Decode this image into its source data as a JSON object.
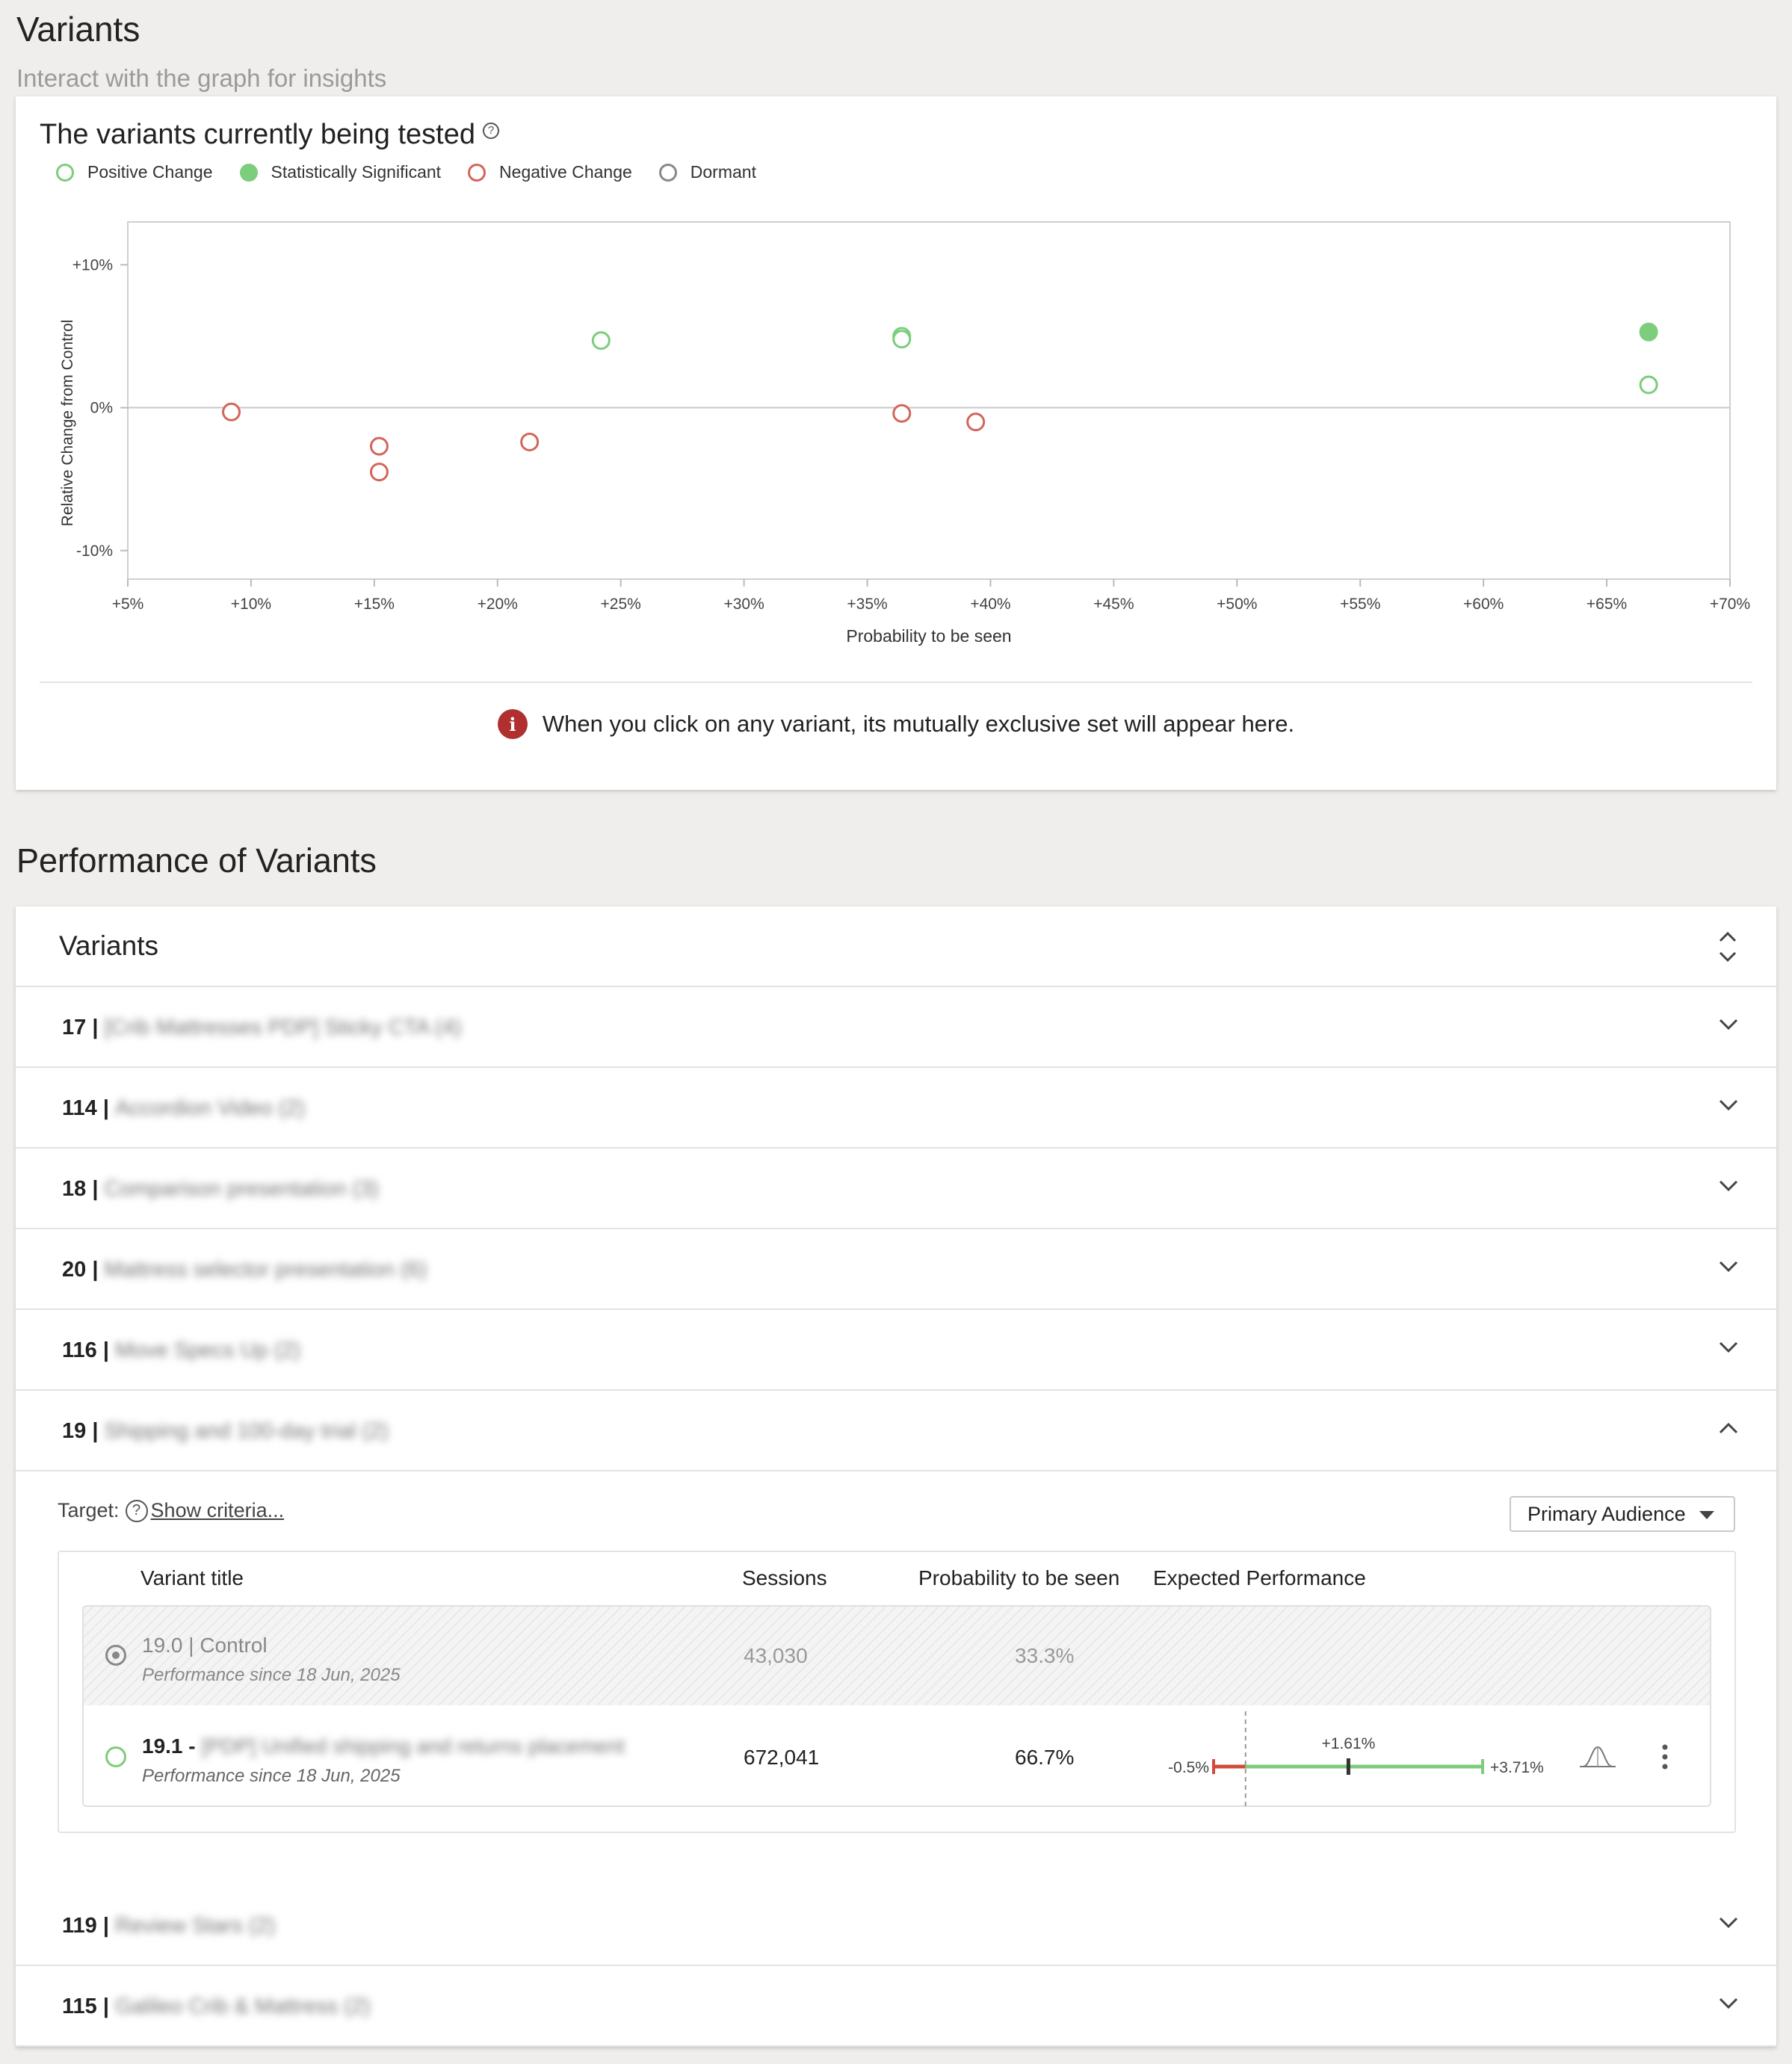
{
  "page": {
    "title": "Variants",
    "subtitle": "Interact with the graph for insights"
  },
  "chart_card": {
    "title": "The variants currently being tested",
    "info_message": "When you click on any variant, its mutually exclusive set will appear here.",
    "legend": [
      {
        "label": "Positive Change",
        "color": "#7ccd7c",
        "filled": false
      },
      {
        "label": "Statistically Significant",
        "color": "#7ccd7c",
        "filled": true
      },
      {
        "label": "Negative Change",
        "color": "#d2665a",
        "filled": false
      },
      {
        "label": "Dormant",
        "color": "#888888",
        "filled": false
      }
    ]
  },
  "chart_data": {
    "type": "scatter",
    "xlabel": "Probability to be seen",
    "ylabel": "Relative Change from Control",
    "xlim": [
      5,
      70
    ],
    "ylim": [
      -12,
      13
    ],
    "x_ticks": [
      5,
      10,
      15,
      20,
      25,
      30,
      35,
      40,
      45,
      50,
      55,
      60,
      65,
      70
    ],
    "x_tick_labels": [
      "+5%",
      "+10%",
      "+15%",
      "+20%",
      "+25%",
      "+30%",
      "+35%",
      "+40%",
      "+45%",
      "+50%",
      "+55%",
      "+60%",
      "+65%",
      "+70%"
    ],
    "y_ticks": [
      10,
      0,
      -10
    ],
    "y_tick_labels": [
      "+10%",
      "0%",
      "-10%"
    ],
    "series": [
      {
        "points": [
          [
            24.2,
            4.7
          ],
          [
            36.4,
            5.0
          ],
          [
            36.4,
            4.8
          ],
          [
            66.7,
            1.6
          ]
        ],
        "status": "positive"
      },
      {
        "points": [
          [
            66.7,
            5.3
          ]
        ],
        "status": "significant"
      },
      {
        "points": [
          [
            9.2,
            -0.3
          ],
          [
            15.2,
            -2.7
          ],
          [
            15.2,
            -4.5
          ],
          [
            21.3,
            -2.4
          ],
          [
            36.4,
            -0.4
          ],
          [
            39.4,
            -1.0
          ]
        ],
        "status": "negative"
      }
    ]
  },
  "performance": {
    "section_title": "Performance of Variants",
    "header_title": "Variants",
    "rows": [
      {
        "num": "17 |",
        "name": "[Crib Mattresses PDP] Sticky CTA (4)",
        "expanded": false
      },
      {
        "num": "114 |",
        "name": "Accordion Video (2)",
        "expanded": false
      },
      {
        "num": "18 |",
        "name": "Comparison presentation (3)",
        "expanded": false
      },
      {
        "num": "20 |",
        "name": "Mattress selector presentation (6)",
        "expanded": false
      },
      {
        "num": "116 |",
        "name": "Move Specs Up (2)",
        "expanded": false
      },
      {
        "num": "19 |",
        "name": "Shipping and 100-day trial (2)",
        "expanded": true
      },
      {
        "num": "119 |",
        "name": "Review Stars (2)",
        "expanded": false
      },
      {
        "num": "115 |",
        "name": "Galileo Crib & Mattress (2)",
        "expanded": false
      }
    ],
    "expanded_detail": {
      "target_label": "Target:",
      "show_criteria": "Show criteria...",
      "audience": "Primary Audience",
      "columns": [
        "Variant title",
        "Sessions",
        "Probability to be seen",
        "Expected Performance"
      ],
      "control": {
        "title": "19.0 | Control",
        "since": "Performance since 18 Jun, 2025",
        "sessions": "43,030",
        "probability": "33.3%"
      },
      "variant": {
        "title": "19.1 -",
        "name": "[PDP] Unified shipping and returns placement",
        "since": "Performance since 18 Jun, 2025",
        "sessions": "672,041",
        "probability": "66.7%",
        "expected_low": -0.5,
        "expected_mid": 1.61,
        "expected_high": 3.71,
        "expected_low_label": "-0.5%",
        "expected_mid_label": "+1.61%",
        "expected_high_label": "+3.71%"
      }
    }
  }
}
